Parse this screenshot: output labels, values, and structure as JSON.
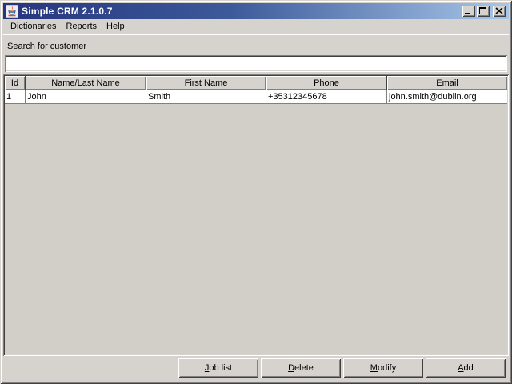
{
  "window": {
    "title": "Simple CRM 2.1.0.7",
    "icons": {
      "app": "java-coffee-cup-icon",
      "minimize": "minimize-icon",
      "maximize": "maximize-icon",
      "close": "close-icon"
    }
  },
  "menu": {
    "items": [
      {
        "name": "dictionaries",
        "pre": "Dic",
        "mn": "t",
        "post": "ionaries"
      },
      {
        "name": "reports",
        "pre": "",
        "mn": "R",
        "post": "eports"
      },
      {
        "name": "help",
        "pre": "",
        "mn": "H",
        "post": "elp"
      }
    ]
  },
  "search": {
    "label": "Search for customer",
    "value": ""
  },
  "table": {
    "columns": [
      "Id",
      "Name/Last Name",
      "First Name",
      "Phone",
      "Email"
    ],
    "rows": [
      {
        "id": "1",
        "last_name": "John",
        "first_name": "Smith",
        "phone": "+35312345678",
        "email": "john.smith@dublin.org"
      }
    ]
  },
  "buttons": [
    {
      "name": "job-list",
      "pre": "",
      "mn": "J",
      "post": "ob list"
    },
    {
      "name": "delete",
      "pre": "",
      "mn": "D",
      "post": "elete"
    },
    {
      "name": "modify",
      "pre": "",
      "mn": "M",
      "post": "odify"
    },
    {
      "name": "add",
      "pre": "",
      "mn": "A",
      "post": "dd"
    }
  ],
  "colors": {
    "titlebar_start": "#26357e",
    "titlebar_end": "#a7c7e9",
    "window_bg": "#d6d3ce",
    "table_row_bg": "#ffffff",
    "grid_line": "#808080"
  }
}
